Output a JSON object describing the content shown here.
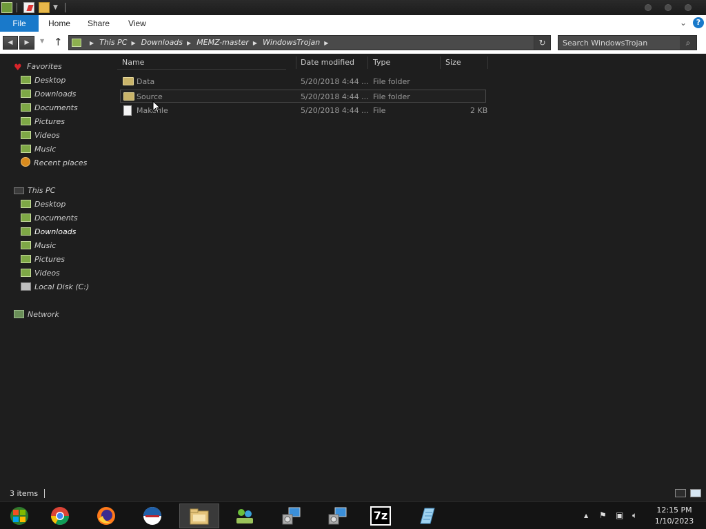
{
  "ribbon": {
    "file_label": "File",
    "tabs": [
      "Home",
      "Share",
      "View"
    ]
  },
  "address": {
    "crumbs": [
      "This PC",
      "Downloads",
      "MEMZ-master",
      "WindowsTrojan"
    ]
  },
  "search": {
    "placeholder": "Search WindowsTrojan"
  },
  "navpane": {
    "favorites": {
      "label": "Favorites",
      "items": [
        "Desktop",
        "Downloads",
        "Documents",
        "Pictures",
        "Videos",
        "Music",
        "Recent places"
      ]
    },
    "this_pc": {
      "label": "This PC",
      "items": [
        "Desktop",
        "Documents",
        "Downloads",
        "Music",
        "Pictures",
        "Videos",
        "Local Disk (C:)"
      ],
      "selected": "Downloads"
    },
    "network": {
      "label": "Network"
    }
  },
  "filelist": {
    "columns": [
      "Name",
      "Date modified",
      "Type",
      "Size"
    ],
    "rows": [
      {
        "name": "Data",
        "date": "5/20/2018 4:44 ...",
        "type": "File folder",
        "size": "",
        "icon": "folder-icon"
      },
      {
        "name": "Source",
        "date": "5/20/2018 4:44 ...",
        "type": "File folder",
        "size": "",
        "icon": "folder-icon"
      },
      {
        "name": "Makefile",
        "date": "5/20/2018 4:44 ...",
        "type": "File",
        "size": "2 KB",
        "icon": "file-icon"
      }
    ]
  },
  "status": {
    "items_count": "3 items"
  },
  "taskbar": {
    "apps": [
      "start-orb",
      "chrome",
      "firefox",
      "opera",
      "file-explorer",
      "network-app",
      "installer-1",
      "installer-2",
      "7zip",
      "notepad"
    ],
    "time": "12:15 PM",
    "date": "1/10/2023",
    "sevenzip_label": "7z"
  },
  "colors": {
    "accent": "#1979ca",
    "background": "#1e1e1e",
    "folder": "#c9b46a"
  }
}
